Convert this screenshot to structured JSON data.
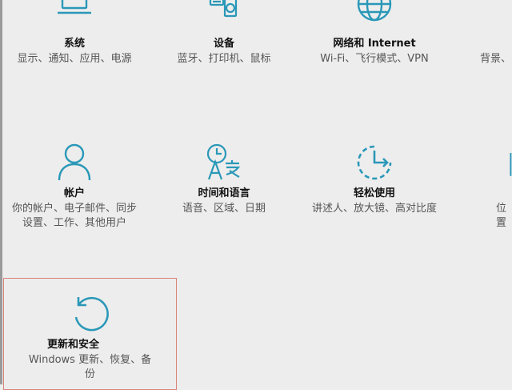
{
  "tiles": [
    {
      "title": "系统",
      "desc": "显示、通知、应用、电源",
      "icon": "laptop-icon"
    },
    {
      "title": "设备",
      "desc": "蓝牙、打印机、鼠标",
      "icon": "devices-icon"
    },
    {
      "title": "网络和 Internet",
      "desc": "Wi-Fi、飞行模式、VPN",
      "icon": "globe-icon"
    },
    {
      "title": "",
      "desc": "背景、",
      "icon": "personalization-icon"
    },
    {
      "title": "帐户",
      "desc": "你的帐户、电子邮件、同步设置、工作、其他用户",
      "icon": "person-icon"
    },
    {
      "title": "时间和语言",
      "desc": "语音、区域、日期",
      "icon": "time-language-icon"
    },
    {
      "title": "轻松使用",
      "desc": "讲述人、放大镜、高对比度",
      "icon": "ease-of-access-icon"
    },
    {
      "title": "",
      "desc": "位置",
      "icon": "privacy-icon"
    },
    {
      "title": "更新和安全",
      "desc": "Windows 更新、恢复、备份",
      "icon": "update-icon"
    }
  ],
  "accent": "#2a98b8",
  "selection_border": "#d9837a"
}
